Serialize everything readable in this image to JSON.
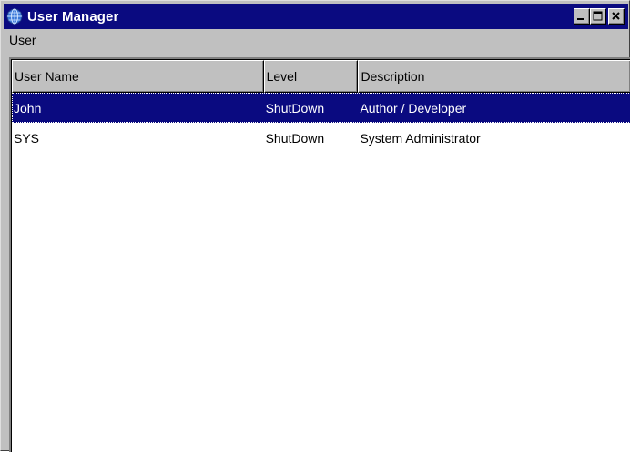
{
  "window": {
    "title": "User Manager",
    "icon": "globe-icon",
    "controls": {
      "minimize": "minimize-icon",
      "maximize": "maximize-icon",
      "close": "close-icon"
    }
  },
  "menubar": {
    "items": [
      {
        "label": "User"
      }
    ]
  },
  "table": {
    "columns": [
      {
        "label": "User Name"
      },
      {
        "label": "Level"
      },
      {
        "label": "Description"
      }
    ],
    "rows": [
      {
        "name": "John",
        "level": "ShutDown",
        "description": "Author / Developer",
        "selected": true
      },
      {
        "name": "SYS",
        "level": "ShutDown",
        "description": "System Administrator",
        "selected": false
      }
    ]
  },
  "colors": {
    "titlebar": "#0a0a80",
    "selection": "#0a0a80",
    "face": "#c0c0c0",
    "list_background": "#ffffff"
  }
}
